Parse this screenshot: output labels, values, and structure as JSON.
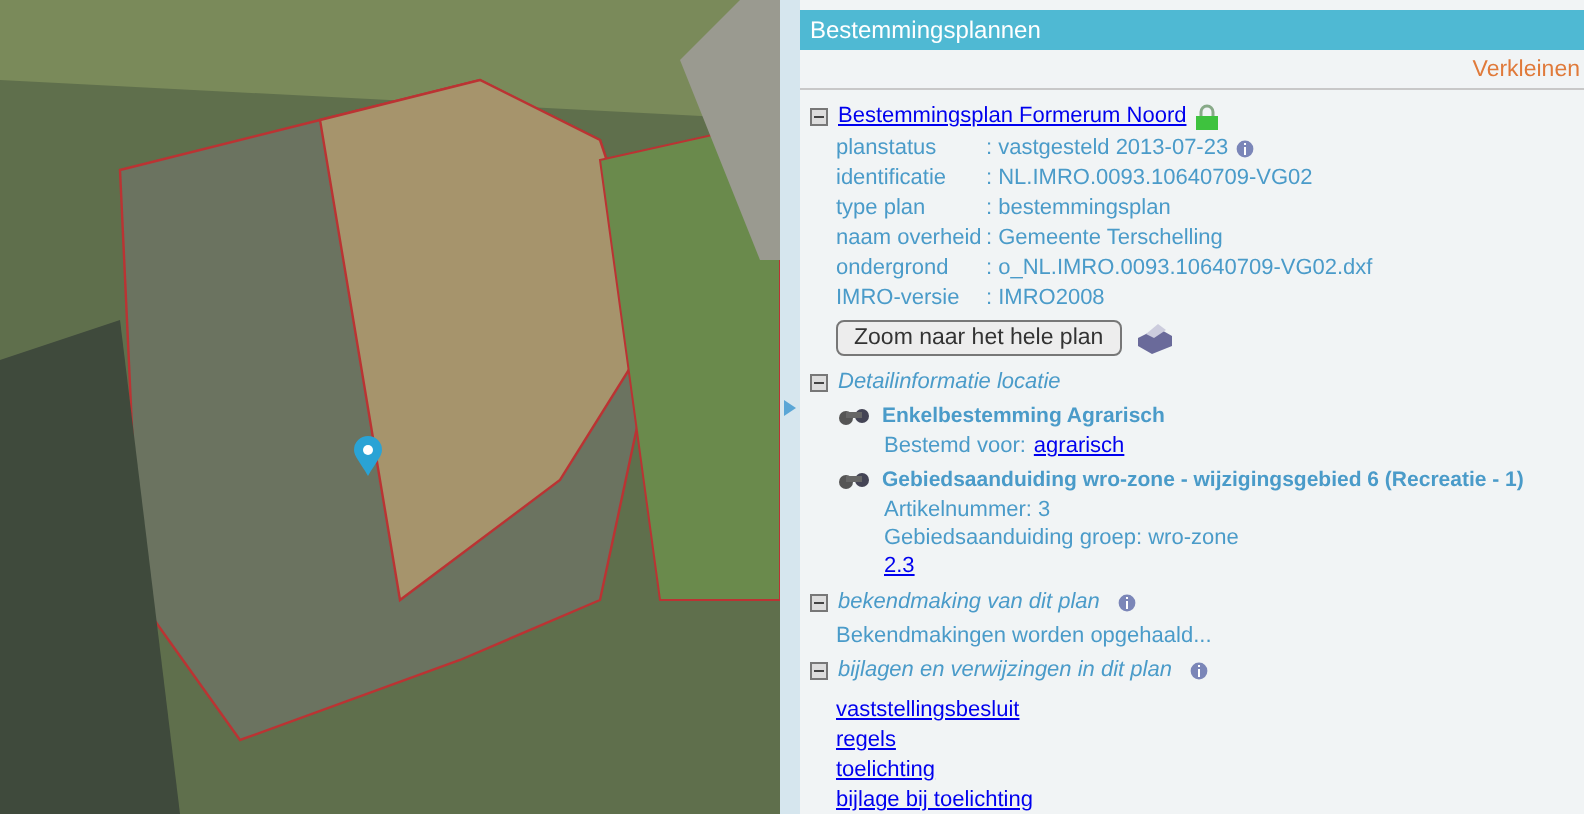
{
  "panel": {
    "title": "Bestemmingsplannen",
    "collapse_link": "Verkleinen"
  },
  "plan": {
    "title": "Bestemmingsplan Formerum Noord",
    "expanded": true,
    "zoom_button": "Zoom naar het hele plan",
    "properties": [
      {
        "label": "planstatus",
        "value": ": vastgesteld 2013-07-23",
        "info": true
      },
      {
        "label": "identificatie",
        "value": ": NL.IMRO.0093.10640709-VG02",
        "info": false
      },
      {
        "label": "type plan",
        "value": ": bestemmingsplan",
        "info": false
      },
      {
        "label": "naam overheid",
        "value": ": Gemeente Terschelling",
        "info": false
      },
      {
        "label": "ondergrond",
        "value": ": o_NL.IMRO.0093.10640709-VG02.dxf",
        "info": false
      },
      {
        "label": "IMRO-versie",
        "value": ": IMRO2008",
        "info": false
      }
    ]
  },
  "sections": [
    {
      "kind": "details",
      "title": "Detailinformatie locatie",
      "expanded": true,
      "info": false,
      "entries": [
        {
          "title": "Enkelbestemming Agrarisch",
          "lines": [
            {
              "text": "Bestemd voor:",
              "link": "agrarisch"
            }
          ]
        },
        {
          "title": "Gebiedsaanduiding wro-zone - wijzigingsgebied 6 (Recreatie - 1)",
          "lines": [
            {
              "text": "Artikelnummer: 3"
            },
            {
              "text": "Gebiedsaanduiding groep: wro-zone"
            },
            {
              "link": "2.3"
            }
          ]
        }
      ]
    },
    {
      "kind": "message",
      "title": "bekendmaking van dit plan",
      "expanded": true,
      "info": true,
      "text": "Bekendmakingen worden opgehaald..."
    },
    {
      "kind": "links",
      "title": "bijlagen en verwijzingen in dit plan",
      "expanded": true,
      "info": true,
      "links": [
        "vaststellingsbesluit",
        "regels",
        "toelichting",
        "bijlage bij toelichting"
      ]
    }
  ]
}
